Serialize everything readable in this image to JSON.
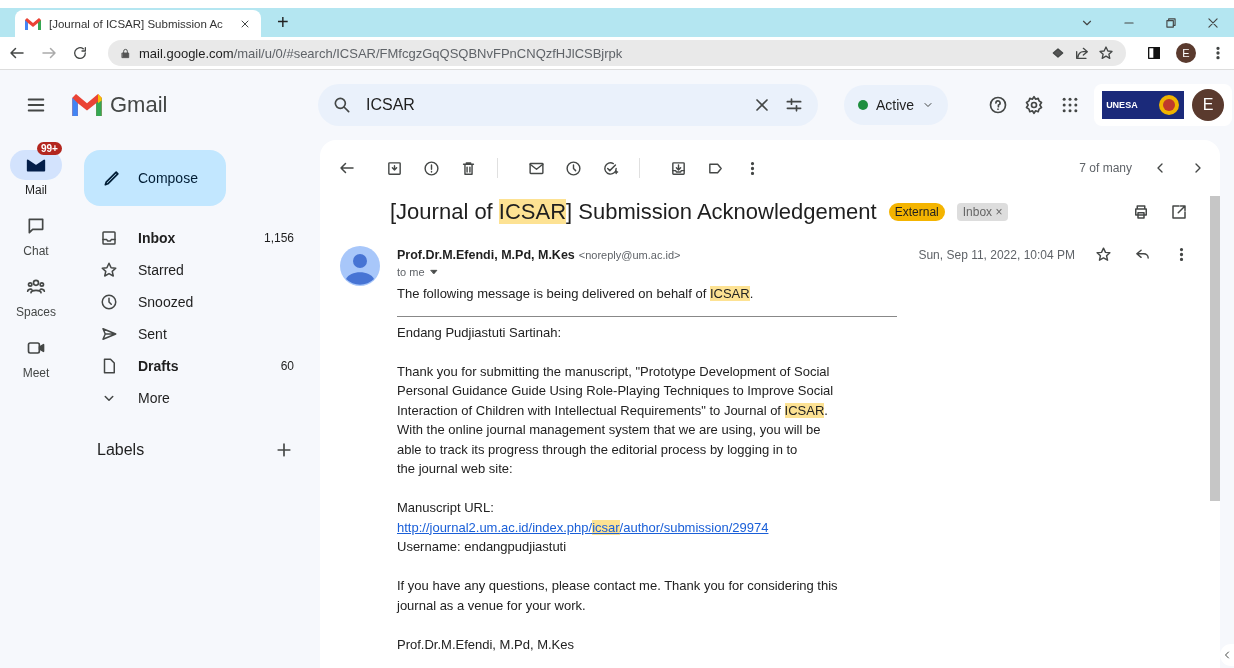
{
  "browser": {
    "tabs": [
      {
        "title": "[Journal of ICSAR] Submission Ac",
        "selected": true
      }
    ],
    "new_tab": "+",
    "url": {
      "domain": "mail.google.com",
      "path": "/mail/u/0/#search/ICSAR/FMfcgzGqQSQBNvFPnCNQzfHJlCSBjrpk"
    },
    "profile_initial": "E"
  },
  "header": {
    "brand": "Gmail",
    "search": {
      "value": "ICSAR"
    },
    "status": "Active",
    "logo_text": "UNESA",
    "account_initial": "E"
  },
  "rail": [
    {
      "label": "Mail",
      "kind": "mail",
      "selected": true,
      "badge": "99+"
    },
    {
      "label": "Chat",
      "kind": "chat",
      "selected": false
    },
    {
      "label": "Spaces",
      "kind": "spaces",
      "selected": false
    },
    {
      "label": "Meet",
      "kind": "meet",
      "selected": false
    }
  ],
  "compose": "Compose",
  "folders": [
    {
      "label": "Inbox",
      "kind": "inbox",
      "unread": true,
      "count": "1,156"
    },
    {
      "label": "Starred",
      "kind": "star",
      "unread": false
    },
    {
      "label": "Snoozed",
      "kind": "clock",
      "unread": false
    },
    {
      "label": "Sent",
      "kind": "send",
      "unread": false
    },
    {
      "label": "Drafts",
      "kind": "draft",
      "unread": true,
      "count": "60"
    },
    {
      "label": "More",
      "kind": "more",
      "unread": false
    }
  ],
  "labels_heading": "Labels",
  "toolbar": {
    "counter": "7 of many"
  },
  "email": {
    "subject": [
      {
        "text": "[Journal of ",
        "highlight": false
      },
      {
        "text": "ICSAR",
        "highlight": true
      },
      {
        "text": "] Submission Acknowledgement",
        "highlight": false
      }
    ],
    "tags": [
      {
        "label": "External",
        "kind": "external"
      },
      {
        "label": "Inbox",
        "kind": "folder",
        "remove": "×"
      }
    ],
    "sender": "Prof.Dr.M.Efendi, M.Pd, M.Kes",
    "sender_email": "<noreply@um.ac.id>",
    "recipient": "to me",
    "date": "Sun, Sep 11, 2022, 10:04 PM",
    "body": [
      {
        "kind": "text",
        "segments": [
          {
            "text": "The following message is being delivered on behalf of ",
            "highlight": false
          },
          {
            "text": "ICSAR",
            "highlight": true
          },
          {
            "text": ".",
            "highlight": false
          }
        ]
      },
      {
        "kind": "rule"
      },
      {
        "kind": "text",
        "segments": [
          {
            "text": "Endang Pudjiastuti Sartinah:",
            "highlight": false
          }
        ]
      },
      {
        "kind": "blank"
      },
      {
        "kind": "text",
        "segments": [
          {
            "text": "Thank you for submitting the manuscript, \"Prototype Development of Social",
            "highlight": false
          }
        ]
      },
      {
        "kind": "text",
        "segments": [
          {
            "text": "Personal Guidance Guide Using Role-Playing Techniques to Improve Social",
            "highlight": false
          }
        ]
      },
      {
        "kind": "text",
        "segments": [
          {
            "text": "Interaction of Children with Intellectual Requirements\" to Journal of ",
            "highlight": false
          },
          {
            "text": "ICSAR",
            "highlight": true
          },
          {
            "text": ".",
            "highlight": false
          }
        ]
      },
      {
        "kind": "text",
        "segments": [
          {
            "text": "With the online journal management system that we are using, you will be",
            "highlight": false
          }
        ]
      },
      {
        "kind": "text",
        "segments": [
          {
            "text": "able to track its progress through the editorial process by logging in to",
            "highlight": false
          }
        ]
      },
      {
        "kind": "text",
        "segments": [
          {
            "text": "the journal web site:",
            "highlight": false
          }
        ]
      },
      {
        "kind": "blank"
      },
      {
        "kind": "text",
        "segments": [
          {
            "text": "Manuscript URL:",
            "highlight": false
          }
        ]
      },
      {
        "kind": "link",
        "segments": [
          {
            "text": "http://journal2.um.ac.id/index.php/",
            "highlight": false
          },
          {
            "text": "icsar",
            "highlight": true
          },
          {
            "text": "/author/submission/29974",
            "highlight": false
          }
        ]
      },
      {
        "kind": "text",
        "segments": [
          {
            "text": "Username: endangpudjiastuti",
            "highlight": false
          }
        ]
      },
      {
        "kind": "blank"
      },
      {
        "kind": "text",
        "segments": [
          {
            "text": "If you have any questions, please contact me. Thank you for considering this",
            "highlight": false
          }
        ]
      },
      {
        "kind": "text",
        "segments": [
          {
            "text": "journal as a venue for your work.",
            "highlight": false
          }
        ]
      },
      {
        "kind": "blank"
      },
      {
        "kind": "text",
        "segments": [
          {
            "text": "Prof.Dr.M.Efendi, M.Pd, M.Kes",
            "highlight": false
          }
        ]
      }
    ]
  }
}
